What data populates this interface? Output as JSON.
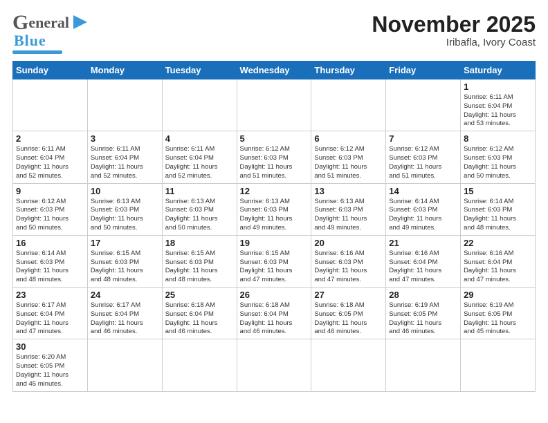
{
  "header": {
    "logo_g": "G",
    "logo_eneral": "eneral",
    "logo_blue": "Blue",
    "month_title": "November 2025",
    "location": "Iribafla, Ivory Coast"
  },
  "weekdays": [
    "Sunday",
    "Monday",
    "Tuesday",
    "Wednesday",
    "Thursday",
    "Friday",
    "Saturday"
  ],
  "weeks": [
    [
      {
        "day": "",
        "info": ""
      },
      {
        "day": "",
        "info": ""
      },
      {
        "day": "",
        "info": ""
      },
      {
        "day": "",
        "info": ""
      },
      {
        "day": "",
        "info": ""
      },
      {
        "day": "",
        "info": ""
      },
      {
        "day": "1",
        "info": "Sunrise: 6:11 AM\nSunset: 6:04 PM\nDaylight: 11 hours\nand 53 minutes."
      }
    ],
    [
      {
        "day": "2",
        "info": "Sunrise: 6:11 AM\nSunset: 6:04 PM\nDaylight: 11 hours\nand 52 minutes."
      },
      {
        "day": "3",
        "info": "Sunrise: 6:11 AM\nSunset: 6:04 PM\nDaylight: 11 hours\nand 52 minutes."
      },
      {
        "day": "4",
        "info": "Sunrise: 6:11 AM\nSunset: 6:04 PM\nDaylight: 11 hours\nand 52 minutes."
      },
      {
        "day": "5",
        "info": "Sunrise: 6:12 AM\nSunset: 6:03 PM\nDaylight: 11 hours\nand 51 minutes."
      },
      {
        "day": "6",
        "info": "Sunrise: 6:12 AM\nSunset: 6:03 PM\nDaylight: 11 hours\nand 51 minutes."
      },
      {
        "day": "7",
        "info": "Sunrise: 6:12 AM\nSunset: 6:03 PM\nDaylight: 11 hours\nand 51 minutes."
      },
      {
        "day": "8",
        "info": "Sunrise: 6:12 AM\nSunset: 6:03 PM\nDaylight: 11 hours\nand 50 minutes."
      }
    ],
    [
      {
        "day": "9",
        "info": "Sunrise: 6:12 AM\nSunset: 6:03 PM\nDaylight: 11 hours\nand 50 minutes."
      },
      {
        "day": "10",
        "info": "Sunrise: 6:13 AM\nSunset: 6:03 PM\nDaylight: 11 hours\nand 50 minutes."
      },
      {
        "day": "11",
        "info": "Sunrise: 6:13 AM\nSunset: 6:03 PM\nDaylight: 11 hours\nand 50 minutes."
      },
      {
        "day": "12",
        "info": "Sunrise: 6:13 AM\nSunset: 6:03 PM\nDaylight: 11 hours\nand 49 minutes."
      },
      {
        "day": "13",
        "info": "Sunrise: 6:13 AM\nSunset: 6:03 PM\nDaylight: 11 hours\nand 49 minutes."
      },
      {
        "day": "14",
        "info": "Sunrise: 6:14 AM\nSunset: 6:03 PM\nDaylight: 11 hours\nand 49 minutes."
      },
      {
        "day": "15",
        "info": "Sunrise: 6:14 AM\nSunset: 6:03 PM\nDaylight: 11 hours\nand 48 minutes."
      }
    ],
    [
      {
        "day": "16",
        "info": "Sunrise: 6:14 AM\nSunset: 6:03 PM\nDaylight: 11 hours\nand 48 minutes."
      },
      {
        "day": "17",
        "info": "Sunrise: 6:15 AM\nSunset: 6:03 PM\nDaylight: 11 hours\nand 48 minutes."
      },
      {
        "day": "18",
        "info": "Sunrise: 6:15 AM\nSunset: 6:03 PM\nDaylight: 11 hours\nand 48 minutes."
      },
      {
        "day": "19",
        "info": "Sunrise: 6:15 AM\nSunset: 6:03 PM\nDaylight: 11 hours\nand 47 minutes."
      },
      {
        "day": "20",
        "info": "Sunrise: 6:16 AM\nSunset: 6:03 PM\nDaylight: 11 hours\nand 47 minutes."
      },
      {
        "day": "21",
        "info": "Sunrise: 6:16 AM\nSunset: 6:04 PM\nDaylight: 11 hours\nand 47 minutes."
      },
      {
        "day": "22",
        "info": "Sunrise: 6:16 AM\nSunset: 6:04 PM\nDaylight: 11 hours\nand 47 minutes."
      }
    ],
    [
      {
        "day": "23",
        "info": "Sunrise: 6:17 AM\nSunset: 6:04 PM\nDaylight: 11 hours\nand 47 minutes."
      },
      {
        "day": "24",
        "info": "Sunrise: 6:17 AM\nSunset: 6:04 PM\nDaylight: 11 hours\nand 46 minutes."
      },
      {
        "day": "25",
        "info": "Sunrise: 6:18 AM\nSunset: 6:04 PM\nDaylight: 11 hours\nand 46 minutes."
      },
      {
        "day": "26",
        "info": "Sunrise: 6:18 AM\nSunset: 6:04 PM\nDaylight: 11 hours\nand 46 minutes."
      },
      {
        "day": "27",
        "info": "Sunrise: 6:18 AM\nSunset: 6:05 PM\nDaylight: 11 hours\nand 46 minutes."
      },
      {
        "day": "28",
        "info": "Sunrise: 6:19 AM\nSunset: 6:05 PM\nDaylight: 11 hours\nand 46 minutes."
      },
      {
        "day": "29",
        "info": "Sunrise: 6:19 AM\nSunset: 6:05 PM\nDaylight: 11 hours\nand 45 minutes."
      }
    ],
    [
      {
        "day": "30",
        "info": "Sunrise: 6:20 AM\nSunset: 6:05 PM\nDaylight: 11 hours\nand 45 minutes."
      },
      {
        "day": "",
        "info": ""
      },
      {
        "day": "",
        "info": ""
      },
      {
        "day": "",
        "info": ""
      },
      {
        "day": "",
        "info": ""
      },
      {
        "day": "",
        "info": ""
      },
      {
        "day": "",
        "info": ""
      }
    ]
  ]
}
